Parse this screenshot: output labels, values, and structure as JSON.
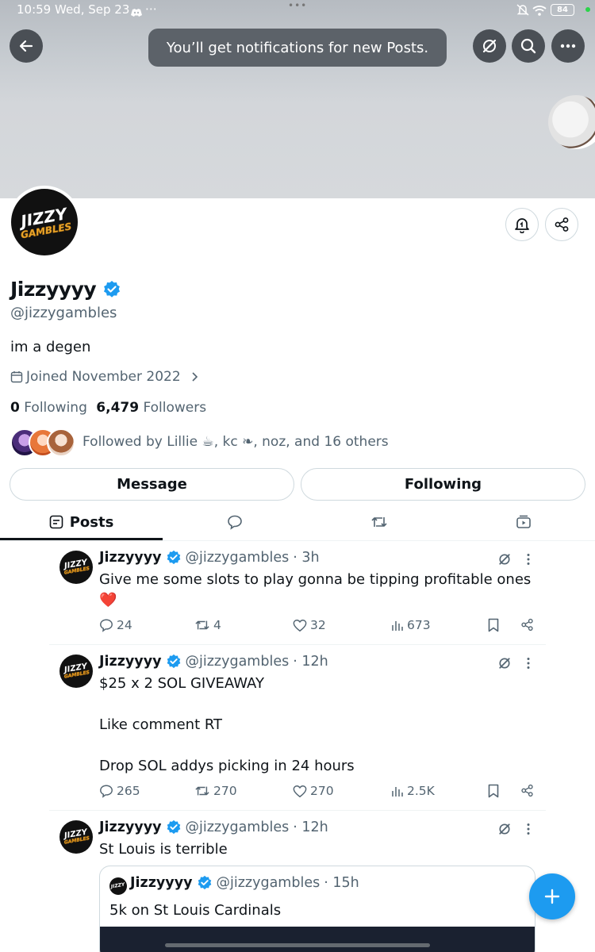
{
  "status_bar": {
    "time": "10:59",
    "date": "Wed, Sep 23",
    "extra": "⋯",
    "center_dots": "•••",
    "battery": "84"
  },
  "toast": {
    "text": "You’ll get notifications for new Posts."
  },
  "profile": {
    "avatar_text_top": "JIZZY",
    "avatar_text_bottom": "GAMBLES",
    "name": "Jizzyyyy",
    "handle": "@jizzygambles",
    "bio": "im a degen",
    "joined": "Joined November 2022",
    "following_count": "0",
    "following_label": "Following",
    "followers_count": "6,479",
    "followers_label": "Followers",
    "followed_by": "Followed by Lillie ☕, kc ❧, noz, and 16 others"
  },
  "buttons": {
    "message": "Message",
    "following": "Following"
  },
  "tabs": {
    "posts": "Posts"
  },
  "posts": [
    {
      "name": "Jizzyyyy",
      "handle": "@jizzygambles",
      "time": "· 3h",
      "text": "Give me some slots to play gonna be tipping profitable ones\n❤️",
      "replies": "24",
      "reposts": "4",
      "likes": "32",
      "views": "673"
    },
    {
      "name": "Jizzyyyy",
      "handle": "@jizzygambles",
      "time": "· 12h",
      "text": "$25 x 2 SOL GIVEAWAY\n\nLike comment RT\n\nDrop SOL addys picking in 24 hours",
      "replies": "265",
      "reposts": "270",
      "likes": "270",
      "views": "2.5K"
    },
    {
      "name": "Jizzyyyy",
      "handle": "@jizzygambles",
      "time": "· 12h",
      "text": "St Louis is terrible"
    }
  ],
  "quote": {
    "name": "Jizzyyyy",
    "handle": "@jizzygambles",
    "time": "· 15h",
    "text": "5k on St Louis Cardinals"
  },
  "colors": {
    "accent": "#1d9bf0",
    "text": "#0f1419",
    "muted": "#536471",
    "heart": "#e0245e"
  }
}
